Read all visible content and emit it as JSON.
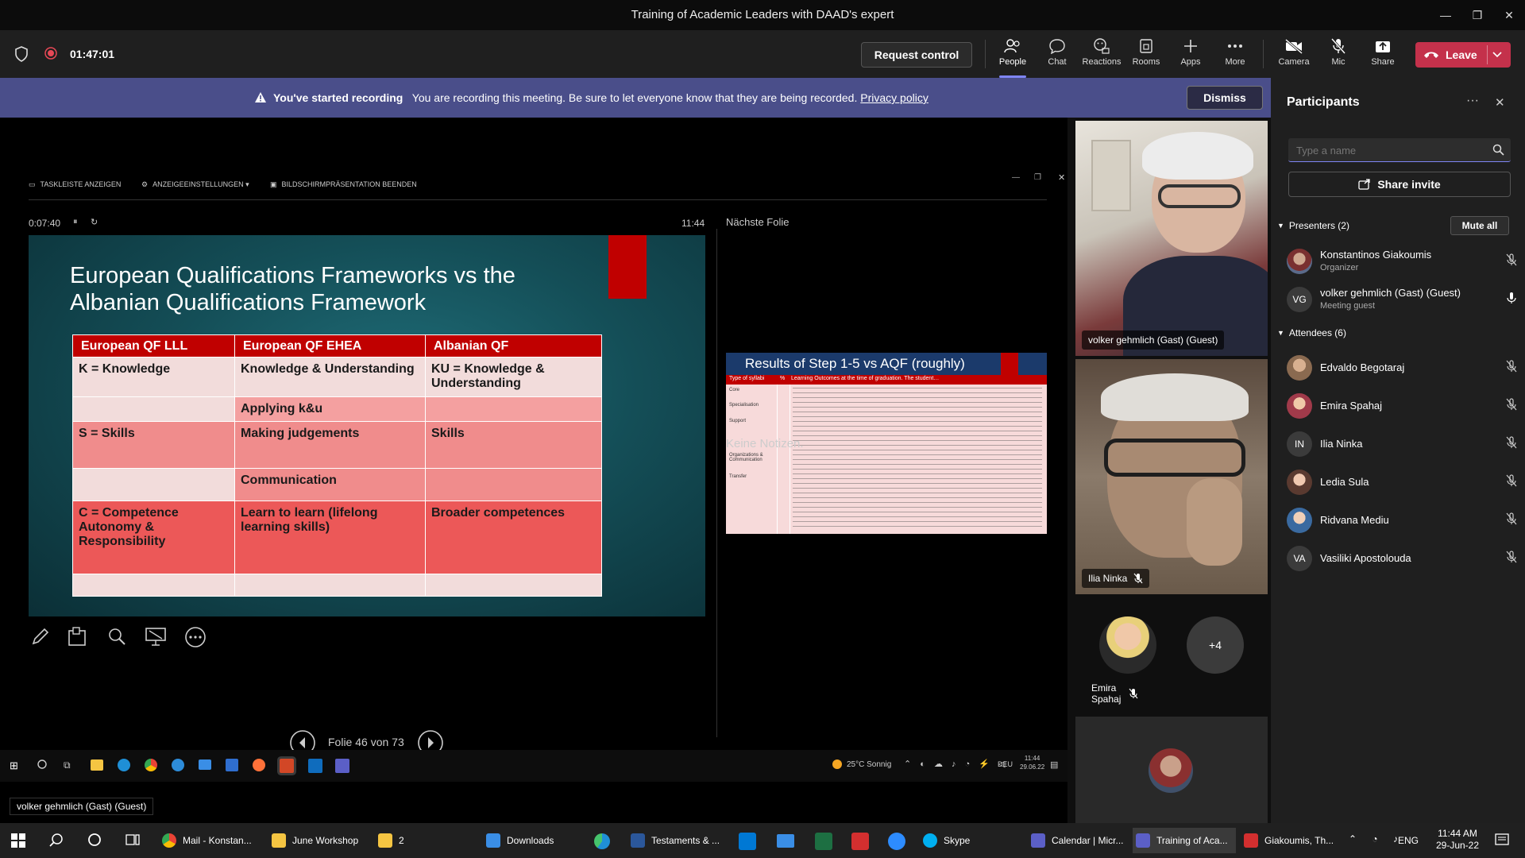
{
  "window": {
    "title": "Training of Academic Leaders with DAAD's expert",
    "controls": [
      "minimize",
      "restore",
      "close"
    ]
  },
  "toolbar": {
    "timer": "01:47:01",
    "request_control": "Request control",
    "buttons": [
      {
        "id": "people",
        "label": "People",
        "icon": "people-icon",
        "active": true
      },
      {
        "id": "chat",
        "label": "Chat",
        "icon": "chat-icon"
      },
      {
        "id": "reactions",
        "label": "Reactions",
        "icon": "reactions-icon"
      },
      {
        "id": "rooms",
        "label": "Rooms",
        "icon": "rooms-icon"
      },
      {
        "id": "apps",
        "label": "Apps",
        "icon": "apps-icon"
      },
      {
        "id": "more",
        "label": "More",
        "icon": "more-icon"
      },
      {
        "id": "camera",
        "label": "Camera",
        "icon": "camera-off-icon"
      },
      {
        "id": "mic",
        "label": "Mic",
        "icon": "mic-off-icon"
      },
      {
        "id": "share",
        "label": "Share",
        "icon": "share-icon"
      }
    ],
    "leave": "Leave"
  },
  "banner": {
    "bold": "You've started recording",
    "text": "You are recording this meeting. Be sure to let everyone know that they are being recorded.",
    "link": "Privacy policy",
    "dismiss": "Dismiss"
  },
  "presenter_view": {
    "top_items": [
      "TASKLEISTE ANZEIGEN",
      "ANZEIGEEINSTELLUNGEN ▾",
      "BILDSCHIRMPRÄSENTATION BEENDEN"
    ],
    "elapsed": "0:07:40",
    "clock": "11:44",
    "next_slide_label": "Nächste Folie",
    "no_notes": "Keine Notizen.",
    "slide_counter": "Folie 46 von 73",
    "slide": {
      "title": "European Qualifications Frameworks vs the Albanian Qualifications Framework",
      "headers": [
        "European QF LLL",
        "European QF EHEA",
        "Albanian QF"
      ],
      "rows": [
        [
          "K = Knowledge",
          "Knowledge & Understanding",
          "KU = Knowledge & Understanding"
        ],
        [
          "",
          "Applying k&u",
          ""
        ],
        [
          "S = Skills",
          "Making judgements",
          "Skills"
        ],
        [
          "",
          "Communication",
          ""
        ],
        [
          "C = Competence Autonomy & Responsibility",
          "Learn to learn (lifelong learning skills)",
          "Broader competences"
        ],
        [
          "",
          "",
          ""
        ]
      ]
    },
    "next_slide": {
      "title": "Results of Step 1-5 vs AQF (roughly)",
      "col1": "Type of syllabi",
      "col2": "%",
      "col3": "Learning Outcomes at the time of graduation. The student…",
      "rows": [
        "Core",
        "Specialisation",
        "Support",
        "Organizations & Communication",
        "Transfer"
      ]
    }
  },
  "inner_taskbar": {
    "weather": "25°C Sonnig",
    "lang": "DEU",
    "time": "11:44",
    "date": "29.06.22"
  },
  "video": {
    "tile1_name": "volker gehmlich (Gast) (Guest)",
    "tile2_name": "Ilia Ninka",
    "small_name": "Emira Spahaj",
    "overflow": "+4",
    "hover_name": "volker gehmlich (Gast) (Guest)"
  },
  "participants": {
    "title": "Participants",
    "search_placeholder": "Type a name",
    "share_invite": "Share invite",
    "presenters_label": "Presenters (2)",
    "mute_all": "Mute all",
    "presenters": [
      {
        "name": "Konstantinos Giakoumis",
        "role": "Organizer",
        "initials": "",
        "color": "#8a6d5a",
        "mic": "off"
      },
      {
        "name": "volker gehmlich (Gast) (Guest)",
        "role": "Meeting guest",
        "initials": "VG",
        "color": "#3b3b3b",
        "mic": "on"
      }
    ],
    "attendees_label": "Attendees (6)",
    "attendees": [
      {
        "name": "Edvaldo Begotaraj",
        "initials": "",
        "color": "#a07a5a"
      },
      {
        "name": "Emira Spahaj",
        "initials": "",
        "color": "#c49a8a"
      },
      {
        "name": "Ilia Ninka",
        "initials": "IN",
        "color": "#3b3b3b"
      },
      {
        "name": "Ledia Sula",
        "initials": "",
        "color": "#b08070"
      },
      {
        "name": "Ridvana Mediu",
        "initials": "",
        "color": "#7a9ac0"
      },
      {
        "name": "Vasiliki Apostolouda",
        "initials": "VA",
        "color": "#3b3b3b"
      }
    ]
  },
  "taskbar": {
    "items": [
      {
        "label": "Mail - Konstan...",
        "color": "#4285f4"
      },
      {
        "label": "June Workshop",
        "color": "#f5c542"
      },
      {
        "label": "2",
        "color": "#f5c542"
      },
      {
        "label": "Downloads",
        "color": "#3a8ee6"
      },
      {
        "label": "Testaments & ...",
        "color": "#2b579a"
      },
      {
        "label": "Skype",
        "color": "#00aff0"
      },
      {
        "label": "Calendar | Micr...",
        "color": "#5b5fc7"
      },
      {
        "label": "Training of Aca...",
        "color": "#5b5fc7"
      },
      {
        "label": "Giakoumis, Th...",
        "color": "#d32f2f"
      }
    ],
    "lang": "ENG",
    "time": "11:44 AM",
    "date": "29-Jun-22"
  }
}
